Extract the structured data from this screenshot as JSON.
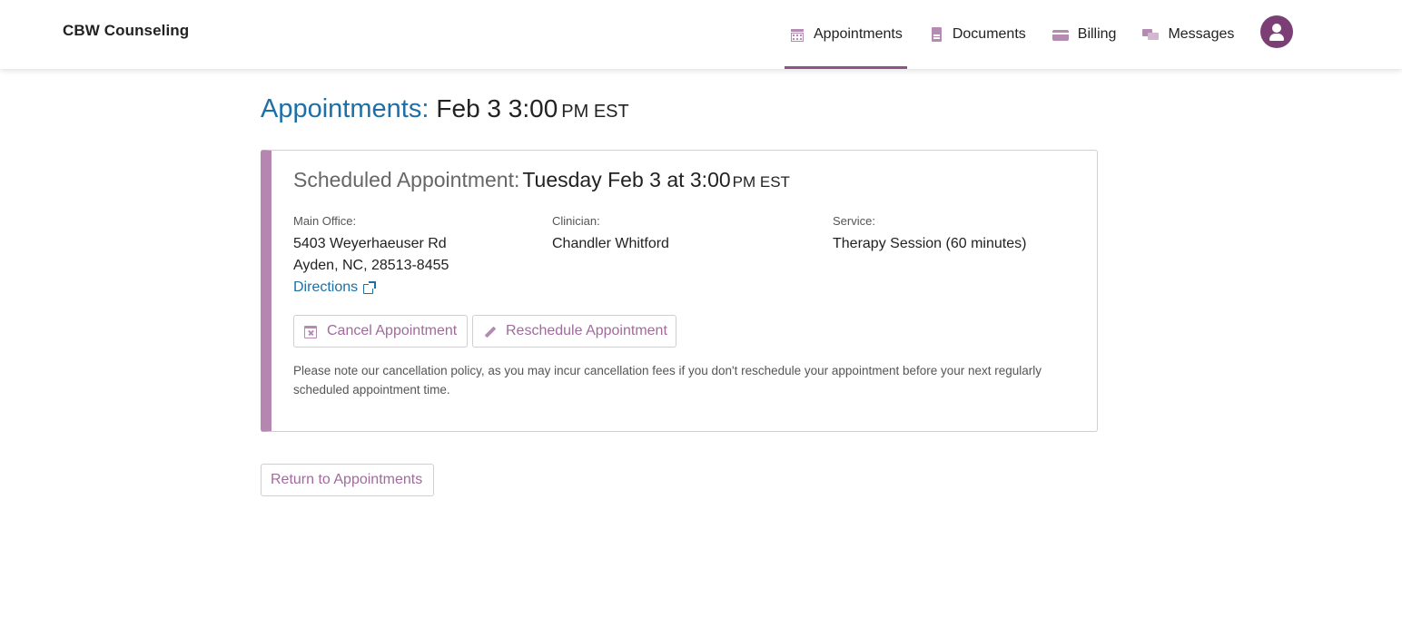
{
  "header": {
    "brand": "CBW Counseling",
    "nav": [
      {
        "label": "Appointments",
        "icon": "calendar-icon",
        "active": true
      },
      {
        "label": "Documents",
        "icon": "document-icon",
        "active": false
      },
      {
        "label": "Billing",
        "icon": "credit-card-icon",
        "active": false
      },
      {
        "label": "Messages",
        "icon": "messages-icon",
        "active": false
      }
    ],
    "avatar_icon": "user-icon"
  },
  "page": {
    "title_label": "Appointments:",
    "title_date": "Feb 3 3:00",
    "title_ampm": "PM EST"
  },
  "appointment": {
    "heading_label": "Scheduled Appointment:",
    "heading_value": "Tuesday Feb 3 at 3:00",
    "heading_ampm": "PM EST",
    "office_label": "Main Office:",
    "office_line1": "5403 Weyerhaeuser Rd",
    "office_line2": "Ayden, NC, 28513-8455",
    "directions_label": "Directions",
    "clinician_label": "Clinician:",
    "clinician_name": "Chandler Whitford",
    "service_label": "Service:",
    "service_name": "Therapy Session (60 minutes)",
    "cancel_label": "Cancel Appointment",
    "reschedule_label": "Reschedule Appointment",
    "policy_text": "Please note our cancellation policy, as you may incur cancellation fees if you don't reschedule your appointment before your next regularly scheduled appointment time."
  },
  "footer": {
    "return_label": "Return to Appointments"
  },
  "colors": {
    "accent": "#8a5687",
    "link": "#1e6fa6",
    "card_border_accent": "#b486b0",
    "avatar": "#7b3f75"
  }
}
